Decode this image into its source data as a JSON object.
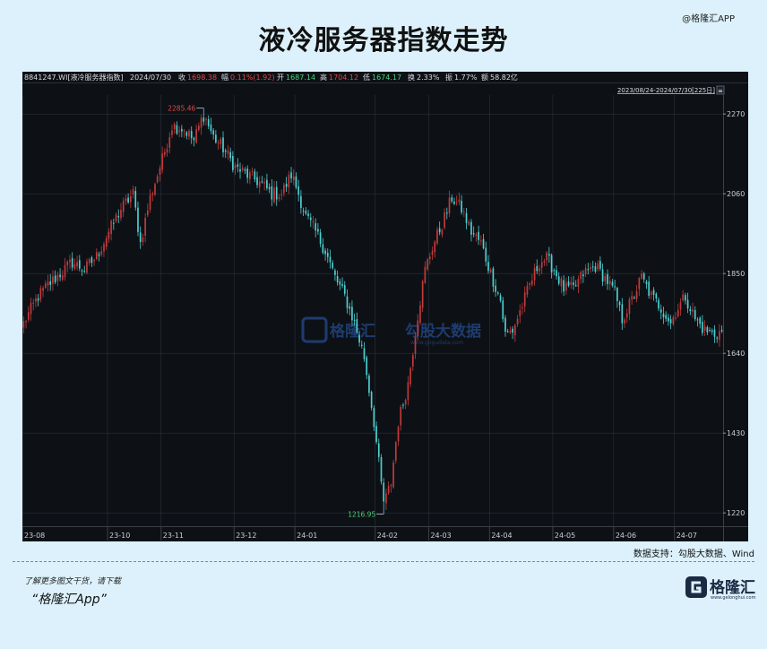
{
  "watermark_top": "@格隆汇APP",
  "title": "液冷服务器指数走势",
  "header": {
    "code": "8841247.WI[液冷服务器指数]",
    "date": "2024/07/30",
    "close_label": "收",
    "close_value": "1698.38",
    "change_label": "幅",
    "change_value": "0.11%(1.92)",
    "open_label": "开",
    "open_value": "1687.14",
    "high_label": "高",
    "high_value": "1704.12",
    "low_label": "低",
    "low_value": "1674.17",
    "turnover_label": "换",
    "turnover_value": "2.33%",
    "amplitude_label": "振",
    "amplitude_value": "1.77%",
    "amount_label": "额",
    "amount_value": "58.82亿",
    "range": "2023/08/24-2024/07/30[225日]"
  },
  "chart_data": {
    "type": "candlestick",
    "y_ticks": [
      "2270",
      "2060",
      "1850",
      "1640",
      "1430",
      "1220"
    ],
    "ylim": [
      1185,
      2320
    ],
    "x_ticks": [
      "23-08",
      "23-10",
      "23-11",
      "23-12",
      "24-01",
      "24-02",
      "24-03",
      "24-04",
      "24-05",
      "24-06",
      "24-07"
    ],
    "x_tick_index": [
      0,
      35,
      57,
      87,
      112,
      145,
      167,
      192,
      218,
      243,
      268
    ],
    "total_bars": 288,
    "max_label": "2285.46",
    "max_index": 74,
    "min_label": "1216.95",
    "min_index": 148,
    "watermark": "勾股大数据",
    "watermark_url": "www.gogudata.com",
    "anchors": [
      [
        0,
        1720
      ],
      [
        6,
        1790
      ],
      [
        10,
        1820
      ],
      [
        15,
        1850
      ],
      [
        20,
        1880
      ],
      [
        25,
        1860
      ],
      [
        30,
        1895
      ],
      [
        35,
        1960
      ],
      [
        40,
        2020
      ],
      [
        45,
        2060
      ],
      [
        48,
        1930
      ],
      [
        52,
        2050
      ],
      [
        57,
        2150
      ],
      [
        61,
        2240
      ],
      [
        66,
        2230
      ],
      [
        70,
        2200
      ],
      [
        74,
        2270
      ],
      [
        78,
        2210
      ],
      [
        82,
        2180
      ],
      [
        87,
        2130
      ],
      [
        92,
        2110
      ],
      [
        97,
        2090
      ],
      [
        102,
        2060
      ],
      [
        106,
        2060
      ],
      [
        110,
        2110
      ],
      [
        112,
        2080
      ],
      [
        116,
        2000
      ],
      [
        120,
        1960
      ],
      [
        124,
        1910
      ],
      [
        128,
        1840
      ],
      [
        132,
        1790
      ],
      [
        136,
        1720
      ],
      [
        140,
        1630
      ],
      [
        144,
        1460
      ],
      [
        148,
        1240
      ],
      [
        151,
        1300
      ],
      [
        154,
        1460
      ],
      [
        158,
        1560
      ],
      [
        162,
        1740
      ],
      [
        165,
        1860
      ],
      [
        168,
        1920
      ],
      [
        172,
        1980
      ],
      [
        176,
        2050
      ],
      [
        180,
        2020
      ],
      [
        184,
        1960
      ],
      [
        188,
        1930
      ],
      [
        192,
        1850
      ],
      [
        196,
        1780
      ],
      [
        198,
        1690
      ],
      [
        201,
        1700
      ],
      [
        204,
        1750
      ],
      [
        208,
        1820
      ],
      [
        212,
        1880
      ],
      [
        215,
        1890
      ],
      [
        218,
        1860
      ],
      [
        222,
        1810
      ],
      [
        226,
        1810
      ],
      [
        230,
        1850
      ],
      [
        235,
        1870
      ],
      [
        240,
        1830
      ],
      [
        243,
        1800
      ],
      [
        246,
        1730
      ],
      [
        250,
        1780
      ],
      [
        254,
        1840
      ],
      [
        258,
        1790
      ],
      [
        262,
        1760
      ],
      [
        266,
        1720
      ],
      [
        268,
        1750
      ],
      [
        272,
        1790
      ],
      [
        276,
        1730
      ],
      [
        280,
        1700
      ],
      [
        284,
        1690
      ],
      [
        287,
        1698
      ]
    ]
  },
  "source": "数据支持：勾股大数据、Wind",
  "footer_note": "了解更多图文干货，请下载",
  "footer_app": "“格隆汇App”",
  "logo": {
    "text": "格隆汇",
    "sub": "www.gelonghui.com"
  },
  "colors": {
    "up": "#c23a3a",
    "down": "#4ecfd0",
    "bg": "#0d1116",
    "grid": "#2b3138"
  }
}
